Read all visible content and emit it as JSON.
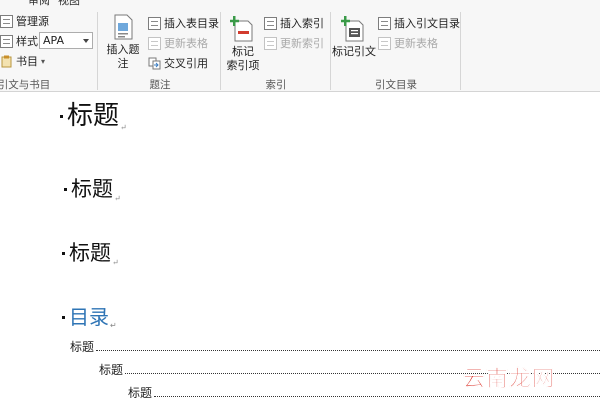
{
  "ribbon": {
    "tabs_partial": [
      "审阅",
      "视图"
    ],
    "citations_group": {
      "label": "引文与书目",
      "manage_sources": "管理源",
      "style_label": "样式:",
      "style_value": "APA",
      "bibliography": "书目"
    },
    "captions_group": {
      "label": "题注",
      "insert_caption": "插入题注",
      "insert_table_of_figures": "插入表目录",
      "update_table": "更新表格",
      "cross_reference": "交叉引用"
    },
    "index_group": {
      "label": "索引",
      "mark_entry": "标记\n索引项",
      "insert_index": "插入索引",
      "update_index": "更新索引"
    },
    "toa_group": {
      "label": "引文目录",
      "mark_citation": "标记引文",
      "insert_toa": "插入引文目录",
      "update_table": "更新表格"
    }
  },
  "document": {
    "headings": [
      "标题",
      "标题",
      "标题"
    ],
    "toc_title": "目录",
    "toc_entries": [
      "标题",
      "标题",
      "标题"
    ]
  },
  "watermark": "云南龙网",
  "colors": {
    "toc_title": "#2e74b5",
    "watermark": "#d9261c",
    "mark_green": "#3a9a48",
    "mark_red": "#d23b2e"
  }
}
